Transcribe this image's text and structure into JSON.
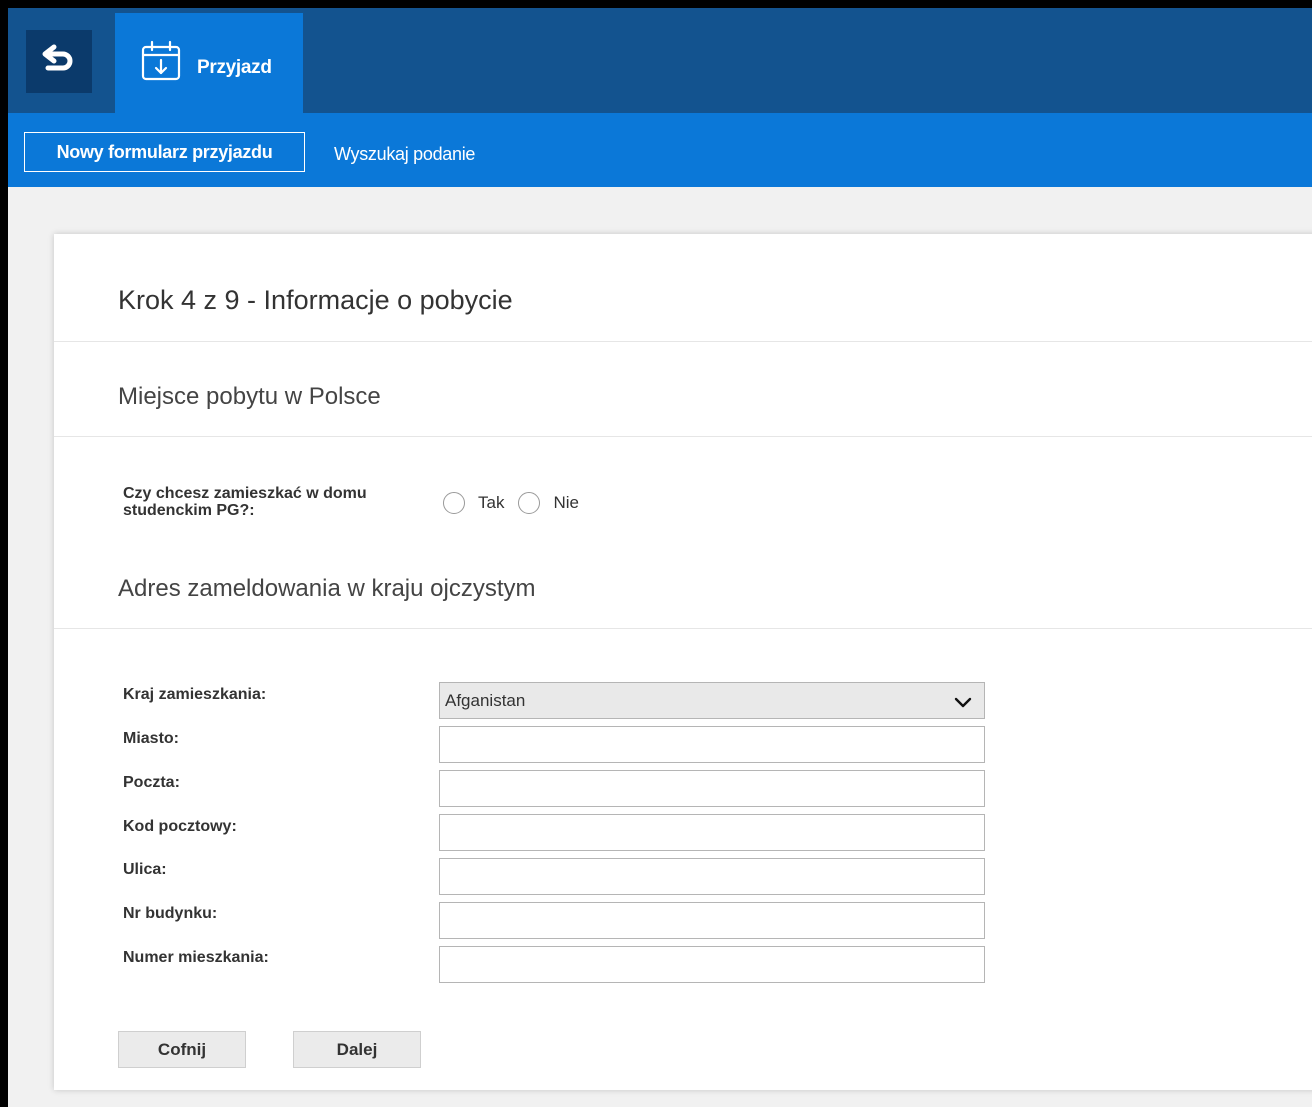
{
  "header": {
    "back_icon": "back-arrow-icon",
    "app_tab": {
      "icon": "calendar-download-icon",
      "label": "Przyjazd"
    }
  },
  "subnav": {
    "active": "Nowy formularz przyjazdu",
    "link": "Wyszukaj podanie"
  },
  "form": {
    "step_title": "Krok 4 z 9 - Informacje o pobycie",
    "section_stay": "Miejsce pobytu w Polsce",
    "dorm_question": "Czy chcesz zamieszkać w domu studenckim PG?:",
    "dorm_options": [
      "Tak",
      "Nie"
    ],
    "section_address": "Adres zameldowania w kraju ojczystym",
    "fields": {
      "country_label": "Kraj zamieszkania:",
      "country_value": "Afganistan",
      "city_label": "Miasto:",
      "post_label": "Poczta:",
      "postal_code_label": "Kod pocztowy:",
      "street_label": "Ulica:",
      "building_label": "Nr budynku:",
      "apartment_label": "Numer mieszkania:"
    },
    "buttons": {
      "back": "Cofnij",
      "next": "Dalej"
    }
  },
  "colors": {
    "topbar": "#13538f",
    "accent": "#0b78d8",
    "back_button": "#0b3a6b"
  }
}
